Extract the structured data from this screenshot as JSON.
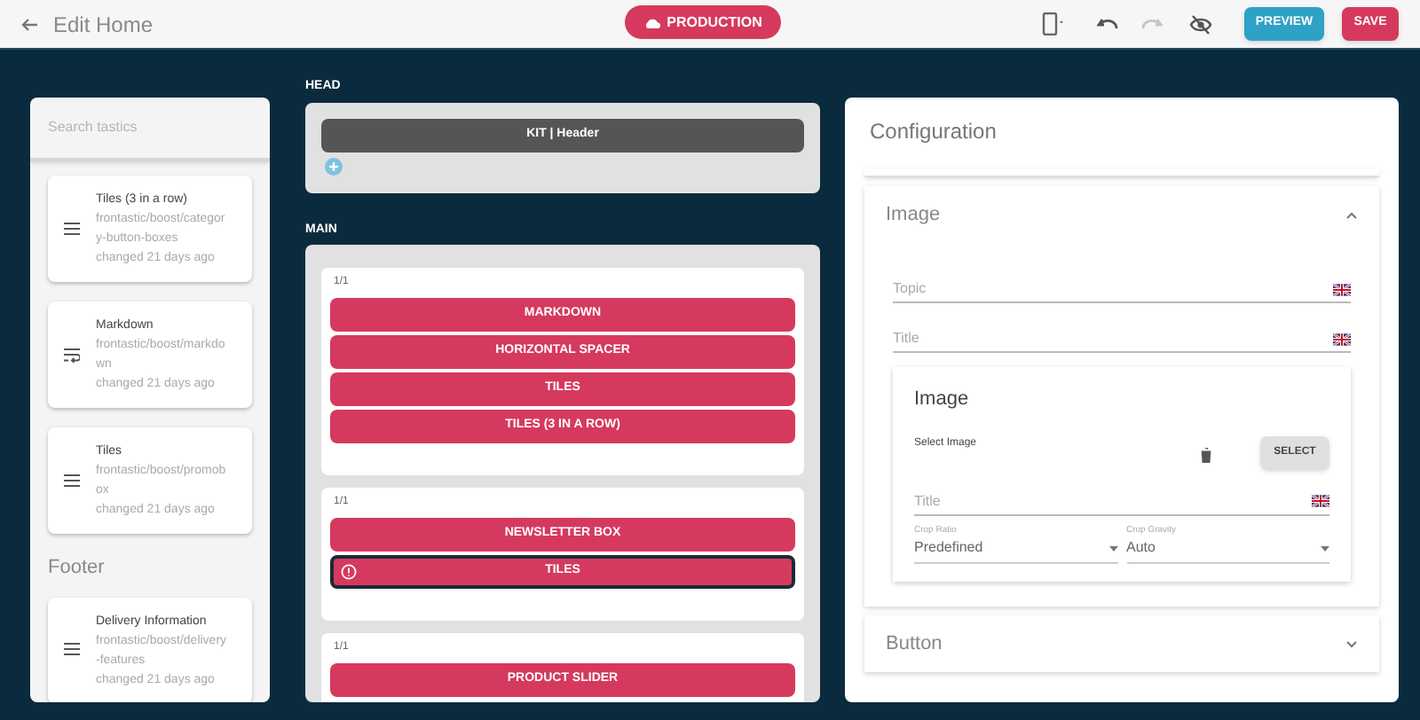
{
  "topbar": {
    "back_label": "Edit Home",
    "environment": "PRODUCTION",
    "actions": [
      {
        "kind": "device"
      },
      {
        "kind": "undo",
        "disabled": false
      },
      {
        "kind": "redo",
        "disabled": true
      },
      {
        "kind": "hide"
      }
    ],
    "buttons": [
      {
        "label": "PREVIEW",
        "kind": "preview"
      },
      {
        "label": "SAVE",
        "kind": "save"
      }
    ]
  },
  "sidebar": {
    "search": {
      "placeholder": "Search tastics"
    },
    "groups": [
      {
        "items": [
          {
            "name": "Tiles (3 in a row)",
            "path": "frontastic/boost/category-button-boxes",
            "changed": "changed 21 days ago",
            "kind": "list"
          },
          {
            "name": "Markdown",
            "path": "frontastic/boost/markdown",
            "changed": "changed 21 days ago",
            "kind": "wrap"
          },
          {
            "name": "Tiles",
            "path": "frontastic/boost/promobox",
            "changed": "changed 21 days ago",
            "kind": "list"
          }
        ]
      },
      {
        "title": "Footer",
        "items": [
          {
            "name": "Delivery Information",
            "path": "frontastic/boost/delivery-features",
            "changed": "changed 21 days ago",
            "kind": "list"
          }
        ]
      }
    ]
  },
  "regions": [
    {
      "label": "HEAD",
      "kind": "head",
      "blocks": [
        {
          "label": "KIT | Header"
        }
      ]
    },
    {
      "label": "MAIN",
      "kind": "main",
      "cells": [
        {
          "size": "1/1",
          "tastics": [
            {
              "label": "MARKDOWN",
              "error": false
            },
            {
              "label": "HORIZONTAL SPACER",
              "error": false
            },
            {
              "label": "TILES",
              "error": false
            },
            {
              "label": "TILES (3 IN A ROW)",
              "error": false
            }
          ]
        },
        {
          "size": "1/1",
          "tastics": [
            {
              "label": "NEWSLETTER BOX",
              "error": false
            },
            {
              "label": "TILES",
              "error": true
            }
          ]
        },
        {
          "size": "1/1",
          "tastics": [
            {
              "label": "PRODUCT SLIDER",
              "error": false
            }
          ]
        }
      ]
    }
  ],
  "configuration": {
    "title": "Configuration",
    "sections": [
      {
        "title": "Image",
        "expanded": true,
        "fields": [
          {
            "placeholder": "Topic"
          },
          {
            "placeholder": "Title"
          }
        ],
        "image": {
          "title": "Image",
          "select_label": "Select Image",
          "select_button": "SELECT",
          "title_field": {
            "placeholder": "Title"
          },
          "selects": [
            {
              "label": "Crop Ratio",
              "value": "Predefined"
            },
            {
              "label": "Crop Gravity",
              "value": "Auto"
            }
          ]
        }
      },
      {
        "title": "Button",
        "expanded": false
      }
    ]
  }
}
